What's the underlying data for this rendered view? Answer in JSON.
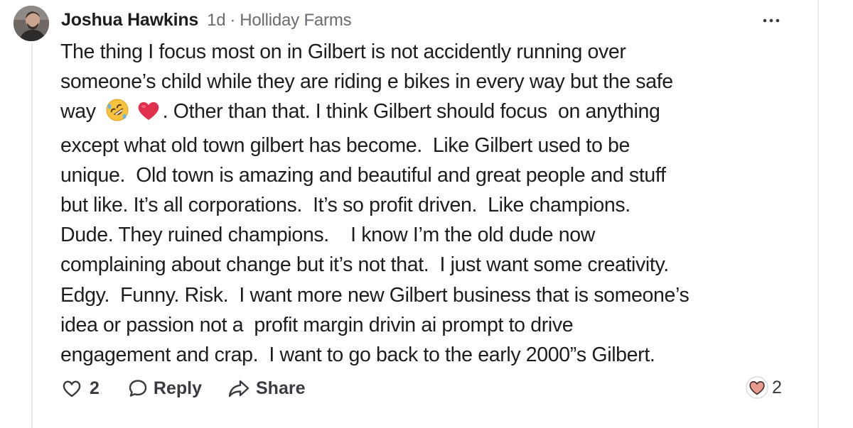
{
  "comment": {
    "author": "Joshua Hawkins",
    "age": "1d",
    "separator": "·",
    "neighborhood": "Holliday Farms",
    "lines": {
      "l1": "The thing I focus most on in Gilbert is not accidently running over",
      "l2": "someone’s child while they are riding e bikes in every way but the safe",
      "l3a": "way",
      "l3b": ". Other than that. I think Gilbert should focus  on anything",
      "l4": "except what old town gilbert has become.  Like Gilbert used to be",
      "l5": "unique.  Old town is amazing and beautiful and great people and stuff",
      "l6": "but like. It’s all corporations.  It’s so profit driven.  Like champions.",
      "l7": "Dude. They ruined champions.    I know I’m the old dude now",
      "l8": "complaining about change but it’s not that.  I just want some creativity.",
      "l9": "Edgy.  Funny. Risk.  I want more new Gilbert business that is someone’s",
      "l10": "idea or passion not a  profit margin drivin ai prompt to drive",
      "l11": "engagement and crap.  I want to go back to the early 2000”s Gilbert."
    },
    "emojis": [
      "rolling-on-floor-laughing-emoji",
      "red-heart-emoji"
    ]
  },
  "actions": {
    "like_count": "2",
    "reply_label": "Reply",
    "share_label": "Share"
  },
  "reactions": {
    "count": "2",
    "icon": "heart-reaction-icon"
  },
  "colors": {
    "text": "#1d1d1f",
    "meta": "#6b6b72",
    "action": "#3a3a40",
    "heart_reaction": "#e89a8f",
    "heart_emoji": "#e0304e",
    "thread_line": "#e6e6ea"
  }
}
